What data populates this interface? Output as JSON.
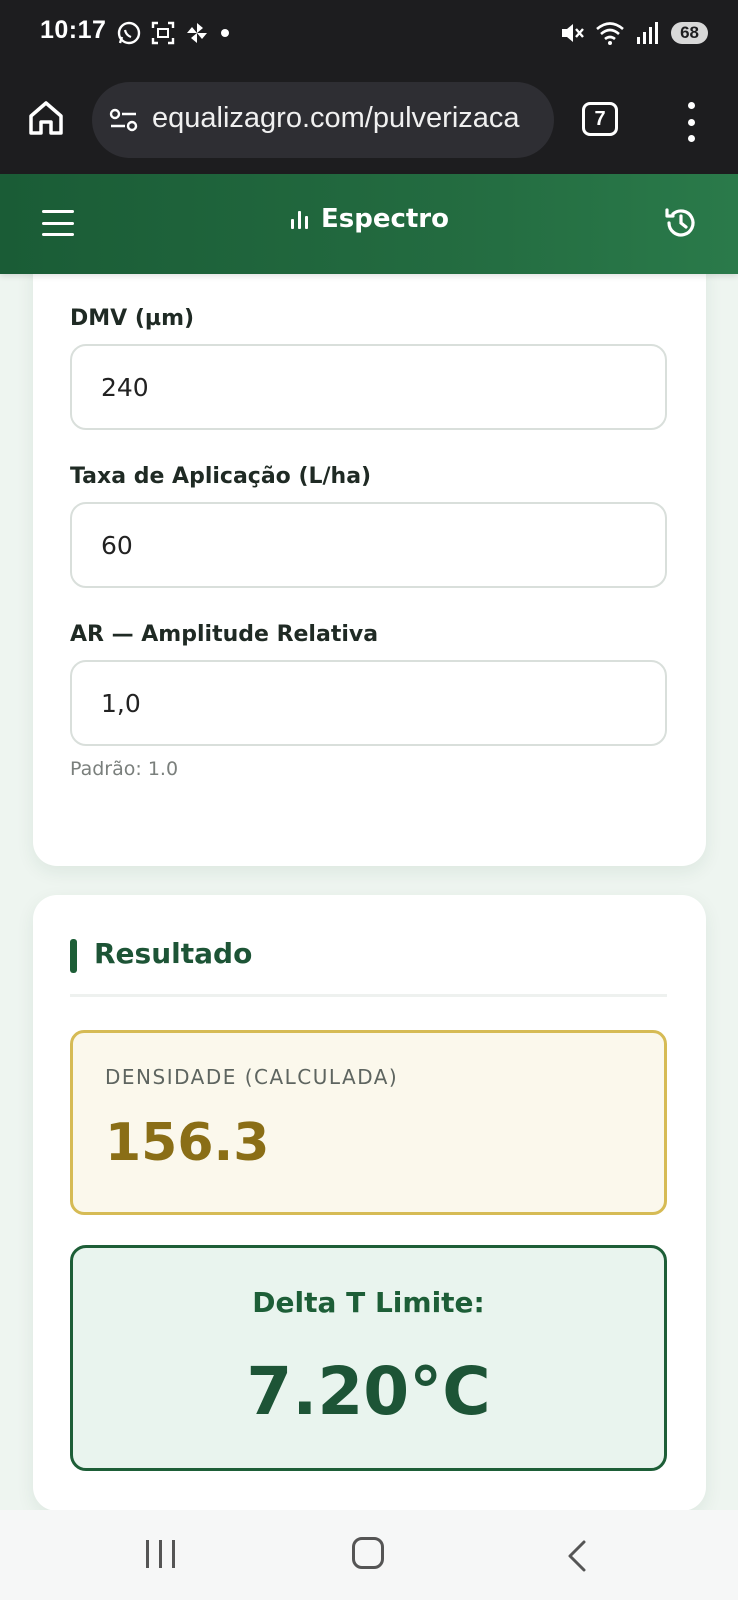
{
  "status_bar": {
    "time": "10:17",
    "battery": "68"
  },
  "browser": {
    "url": "equalizagro.com/pulverizaca",
    "tab_count": "7"
  },
  "app_header": {
    "title": "Espectro"
  },
  "inputs_card": {
    "fields": [
      {
        "label": "DMV (µm)",
        "value": "240"
      },
      {
        "label": "Taxa de Aplicação (L/ha)",
        "value": "60"
      },
      {
        "label": "AR — Amplitude Relativa",
        "value": "1,0"
      }
    ],
    "ar_help": "Padrão: 1.0"
  },
  "result_card": {
    "title": "Resultado",
    "density_label": "DENSIDADE (CALCULADA)",
    "density_value": "156.3",
    "delta_label": "Delta T Limite:",
    "delta_value": "7.20°C"
  },
  "colors": {
    "header_green": "#1a5c36",
    "accent_gold": "#d6bb55",
    "density_text": "#8a6e16",
    "delta_green": "#1d5e37"
  },
  "icons": [
    "whatsapp-icon",
    "screenshot-icon",
    "pinwheel-icon",
    "mute-icon",
    "wifi-icon",
    "signal-icon",
    "home-icon",
    "site-settings-icon",
    "more-vert-icon",
    "menu-icon",
    "bar-chart-icon",
    "history-icon",
    "nav-recent-icon",
    "nav-home-icon",
    "nav-back-icon"
  ]
}
